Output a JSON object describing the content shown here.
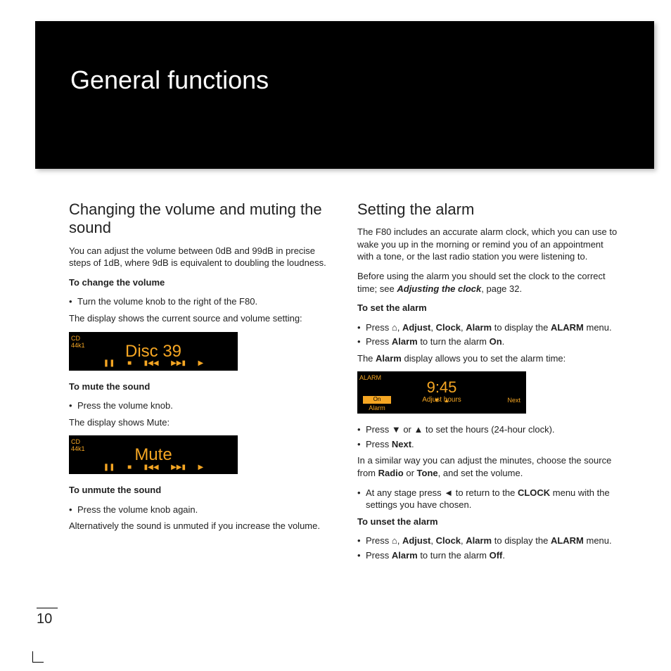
{
  "page_number": "10",
  "hero_title": "General functions",
  "left": {
    "h2": "Changing the volume and muting the sound",
    "intro": "You can adjust the volume between 0dB and 99dB in precise steps of 1dB, where 9dB is equivalent to doubling the loudness.",
    "sec1_h": "To change the volume",
    "sec1_b1": "Turn the volume knob to the right of the F80.",
    "sec1_p": "The display shows the current source and volume setting:",
    "disp1": {
      "tl1": "CD",
      "tl2": "44k1",
      "big": "Disc  39",
      "sym": [
        "❚❚",
        "■",
        "▮◀◀",
        "▶▶▮",
        "▶"
      ]
    },
    "sec2_h": "To mute the sound",
    "sec2_b1": "Press the volume knob.",
    "sec2_p": "The display shows Mute:",
    "disp2": {
      "tl1": "CD",
      "tl2": "44k1",
      "big": "Mute",
      "sym": [
        "❚❚",
        "■",
        "▮◀◀",
        "▶▶▮",
        "▶"
      ]
    },
    "sec3_h": "To unmute the sound",
    "sec3_b1": "Press the volume knob again.",
    "sec3_p": "Alternatively the sound is unmuted if you increase the volume."
  },
  "right": {
    "h2": "Setting the alarm",
    "intro": "The F80 includes an accurate alarm clock, which you can use to wake you up in the morning or remind you of an appointment with a tone, or the last radio station you were listening to.",
    "intro2a": "Before using the alarm you should set the clock to the correct time; see ",
    "intro2b": "Adjusting the clock",
    "intro2c": ", page 32.",
    "sec1_h": "To set the alarm",
    "sec1_b1a": "Press ",
    "sec1_b1_icon": "⌂",
    "sec1_b1b": ", ",
    "sec1_b1_bold": [
      "Adjust",
      "Clock",
      "Alarm"
    ],
    "sec1_b1c": " to display the ",
    "sec1_b1d": "ALARM",
    "sec1_b1e": " menu.",
    "sec1_b2a": "Press ",
    "sec1_b2b": "Alarm",
    "sec1_b2c": " to turn the alarm ",
    "sec1_b2d": "On",
    "sec1_b2e": ".",
    "sec1_p_a": "The ",
    "sec1_p_b": "Alarm",
    "sec1_p_c": " display allows you to set the alarm time:",
    "disp": {
      "title": "ALARM",
      "big": "9:45",
      "sub": "Adjust hours",
      "left_on": "On",
      "left_lab": "Alarm",
      "tri": [
        "▼",
        "▲"
      ],
      "right": "Next"
    },
    "sec2_b1a": "Press ",
    "sec2_b1_tri": [
      "▼",
      "▲"
    ],
    "sec2_b1b": " or ",
    "sec2_b1c": " to set the hours (24-hour clock).",
    "sec2_b2a": "Press ",
    "sec2_b2b": "Next",
    "sec2_b2c": ".",
    "sec2_p_a": "In a similar way you can adjust the minutes, choose the source from ",
    "sec2_p_b": "Radio",
    "sec2_p_c": " or ",
    "sec2_p_d": "Tone",
    "sec2_p_e": ", and set the volume.",
    "sec2_b3a": "At any stage press ",
    "sec2_b3_icon": "◄",
    "sec2_b3b": " to return to the ",
    "sec2_b3c": "CLOCK",
    "sec2_b3d": " menu with the settings you have chosen.",
    "sec3_h": "To unset the alarm",
    "sec3_b1a": "Press ",
    "sec3_b1_icon": "⌂",
    "sec3_b1b": ", ",
    "sec3_b1_bold": [
      "Adjust",
      "Clock",
      "Alarm"
    ],
    "sec3_b1c": " to display the ",
    "sec3_b1d": "ALARM",
    "sec3_b1e": " menu.",
    "sec3_b2a": "Press ",
    "sec3_b2b": "Alarm",
    "sec3_b2c": " to turn the alarm ",
    "sec3_b2d": "Off",
    "sec3_b2e": "."
  }
}
